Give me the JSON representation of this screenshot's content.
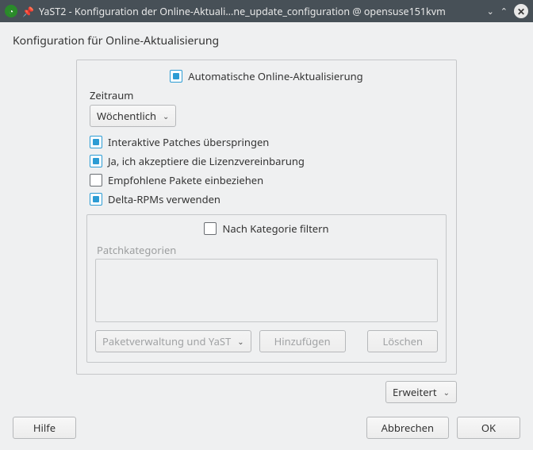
{
  "window": {
    "title": "YaST2 - Konfiguration der Online-Aktuali...ne_update_configuration @ opensuse151kvm"
  },
  "dialog": {
    "title": "Konfiguration für Online-Aktualisierung"
  },
  "master": {
    "label": "Automatische Online-Aktualisierung"
  },
  "period": {
    "label": "Zeitraum",
    "value": "Wöchentlich"
  },
  "opts": {
    "skip_interactive": "Interaktive Patches überspringen",
    "accept_license": "Ja, ich akzeptiere die Lizenzvereinbarung",
    "include_recommended": "Empfohlene Pakete einbeziehen",
    "use_delta": "Delta-RPMs verwenden"
  },
  "filter": {
    "by_category": "Nach Kategorie filtern",
    "cat_label": "Patchkategorien",
    "category_value": "Paketverwaltung und YaST",
    "add": "Hinzufügen",
    "del": "Löschen"
  },
  "advanced": "Erweitert",
  "footer": {
    "help": "Hilfe",
    "cancel": "Abbrechen",
    "ok": "OK"
  }
}
